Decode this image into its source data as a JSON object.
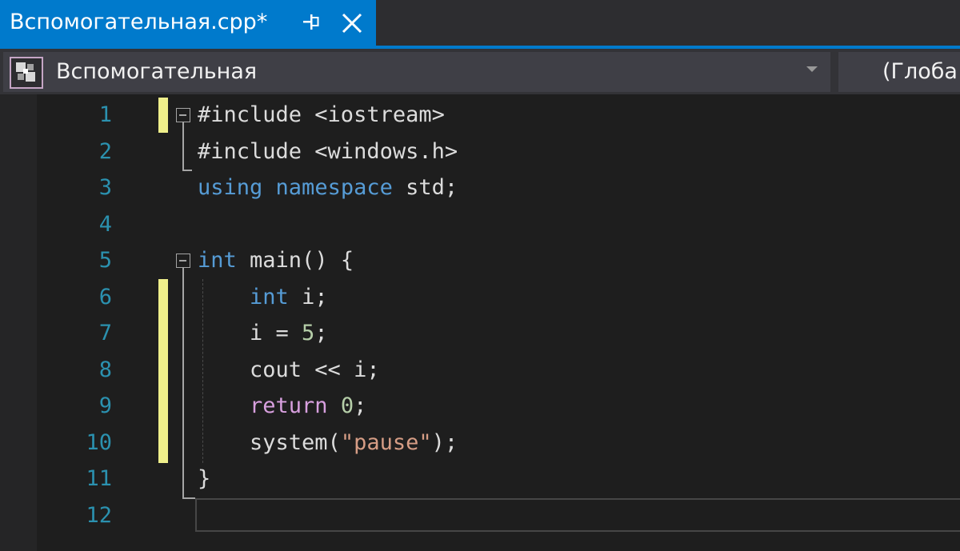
{
  "tab": {
    "title": "Вспомогательная.cpp*",
    "pin_icon": "pin-icon",
    "close_icon": "close-icon"
  },
  "navbar": {
    "project_icon": "cpp-project-icon",
    "project_label": "Вспомогательная",
    "scope_label": "(Глоба"
  },
  "editor": {
    "line_numbers": [
      "1",
      "2",
      "3",
      "4",
      "5",
      "6",
      "7",
      "8",
      "9",
      "10",
      "11",
      "12"
    ],
    "lines": [
      [
        {
          "t": "#include <iostream>",
          "c": "plain"
        }
      ],
      [
        {
          "t": "#include <windows.h>",
          "c": "plain"
        }
      ],
      [
        {
          "t": "using",
          "c": "kw"
        },
        {
          "t": " ",
          "c": "plain"
        },
        {
          "t": "namespace",
          "c": "kw"
        },
        {
          "t": " std;",
          "c": "plain"
        }
      ],
      [],
      [
        {
          "t": "int",
          "c": "kw"
        },
        {
          "t": " main() {",
          "c": "plain"
        }
      ],
      [
        {
          "t": "    ",
          "c": "plain"
        },
        {
          "t": "int",
          "c": "kw"
        },
        {
          "t": " i;",
          "c": "plain"
        }
      ],
      [
        {
          "t": "    i = ",
          "c": "plain"
        },
        {
          "t": "5",
          "c": "num"
        },
        {
          "t": ";",
          "c": "plain"
        }
      ],
      [
        {
          "t": "    cout << i;",
          "c": "plain"
        }
      ],
      [
        {
          "t": "    ",
          "c": "plain"
        },
        {
          "t": "return",
          "c": "ctl"
        },
        {
          "t": " ",
          "c": "plain"
        },
        {
          "t": "0",
          "c": "num"
        },
        {
          "t": ";",
          "c": "plain"
        }
      ],
      [
        {
          "t": "    system(",
          "c": "plain"
        },
        {
          "t": "\"pause\"",
          "c": "str"
        },
        {
          "t": ");",
          "c": "plain"
        }
      ],
      [
        {
          "t": "}",
          "c": "plain"
        }
      ],
      []
    ]
  },
  "colors": {
    "accent": "#007acc",
    "keyword": "#569cd6",
    "control": "#d8a0df",
    "string": "#d69d85",
    "number": "#b5cea8",
    "line_number": "#2b91af",
    "change_marker": "#efef8b"
  }
}
